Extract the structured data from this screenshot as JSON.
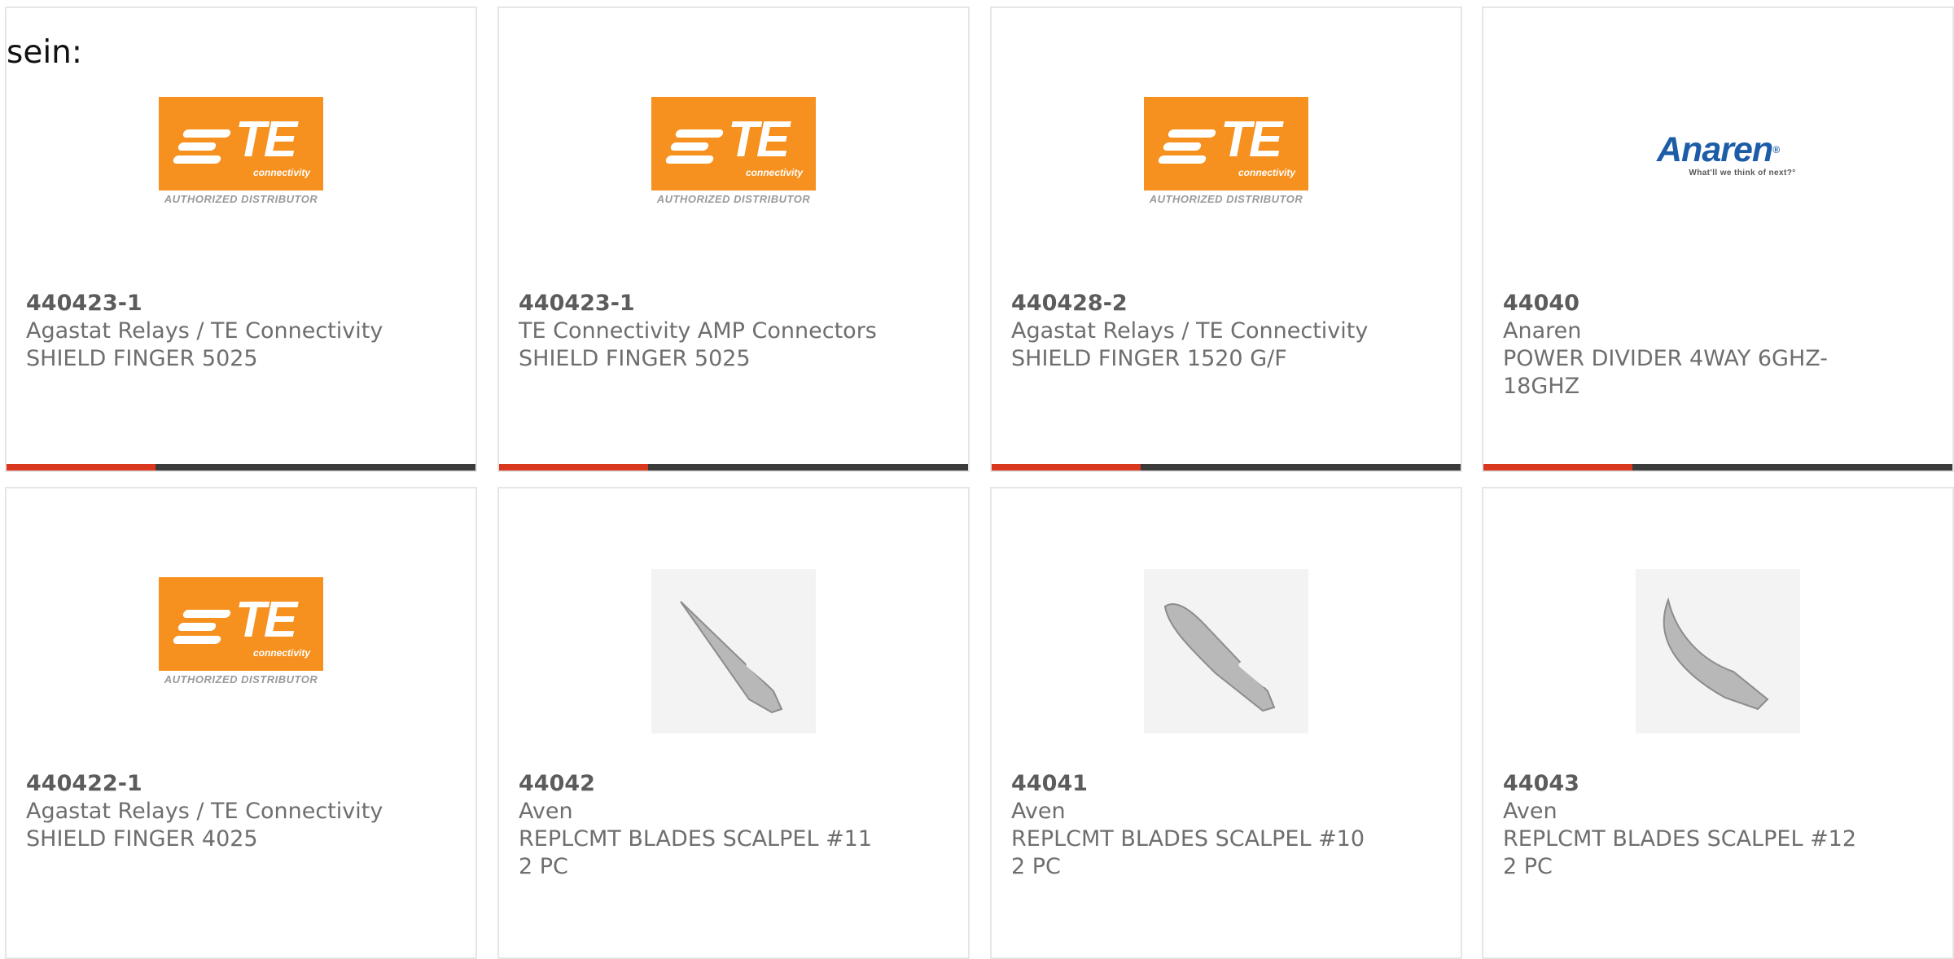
{
  "intro_text": "sein:",
  "colors": {
    "accent": "#d9381e",
    "bar": "#3b3b3b",
    "te_orange": "#f6911f",
    "anaren_blue": "#1d5da8"
  },
  "logos": {
    "te": {
      "letters": "TE",
      "sub": "connectivity",
      "tagline": "AUTHORIZED DISTRIBUTOR"
    },
    "anaren": {
      "name": "Anaren",
      "reg": "®",
      "tagline": "What'll we think of next?°"
    }
  },
  "products": [
    {
      "part_number": "440423-1",
      "manufacturer": "Agastat Relays / TE Connectivity",
      "desc1": "SHIELD FINGER 5025",
      "desc2": "",
      "image": "te-connectivity-logo",
      "has_bar": true
    },
    {
      "part_number": "440423-1",
      "manufacturer": "TE Connectivity AMP Connectors",
      "desc1": "SHIELD FINGER 5025",
      "desc2": "",
      "image": "te-connectivity-logo",
      "has_bar": true
    },
    {
      "part_number": "440428-2",
      "manufacturer": "Agastat Relays / TE Connectivity",
      "desc1": "SHIELD FINGER 1520 G/F",
      "desc2": "",
      "image": "te-connectivity-logo",
      "has_bar": true
    },
    {
      "part_number": "44040",
      "manufacturer": "Anaren",
      "desc1": "POWER DIVIDER 4WAY 6GHZ-",
      "desc2": "18GHZ",
      "image": "anaren-logo",
      "has_bar": true
    },
    {
      "part_number": "440422-1",
      "manufacturer": "Agastat Relays / TE Connectivity",
      "desc1": "SHIELD FINGER 4025",
      "desc2": "",
      "image": "te-connectivity-logo",
      "has_bar": false
    },
    {
      "part_number": "44042",
      "manufacturer": "Aven",
      "desc1": "REPLCMT BLADES SCALPEL #11",
      "desc2": "2 PC",
      "image": "scalpel-blade-11",
      "has_bar": false
    },
    {
      "part_number": "44041",
      "manufacturer": "Aven",
      "desc1": "REPLCMT BLADES SCALPEL #10",
      "desc2": "2 PC",
      "image": "scalpel-blade-10",
      "has_bar": false
    },
    {
      "part_number": "44043",
      "manufacturer": "Aven",
      "desc1": "REPLCMT BLADES SCALPEL #12",
      "desc2": "2 PC",
      "image": "scalpel-blade-12",
      "has_bar": false
    }
  ]
}
